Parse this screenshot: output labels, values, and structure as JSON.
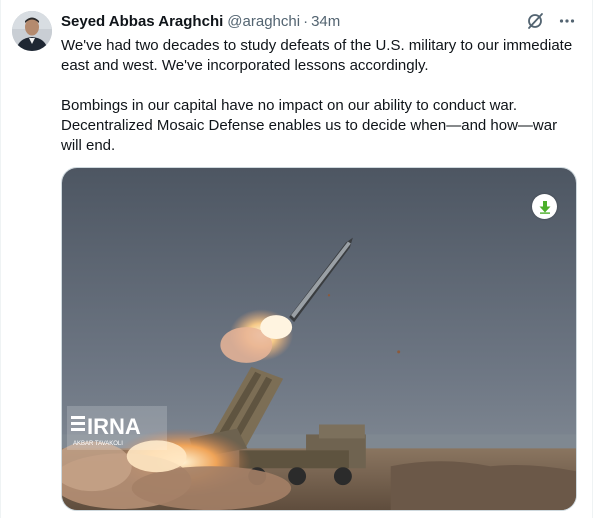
{
  "tweet": {
    "author_name": "Seyed Abbas Araghchi",
    "handle": "@araghchi",
    "separator": "·",
    "time": "34m",
    "paragraphs": [
      "We've had two decades to study defeats of the U.S. military to our immediate east and west. We've incorporated lessons accordingly.",
      "Bombings in our capital have no impact on our ability to conduct war. Decentralized Mosaic Defense enables us to decide when—and how—war will end."
    ]
  },
  "actions": {
    "grok_icon": "grok-icon",
    "more_icon": "more-icon"
  },
  "media": {
    "watermark_logo": "IRNA",
    "watermark_credit": "AKBAR TAVAKOLI",
    "download_icon": "download-arrow-icon",
    "download_color": "#4caf2b"
  },
  "colors": {
    "text_primary": "#0f1419",
    "text_secondary": "#536471",
    "border": "#cfd9de"
  }
}
